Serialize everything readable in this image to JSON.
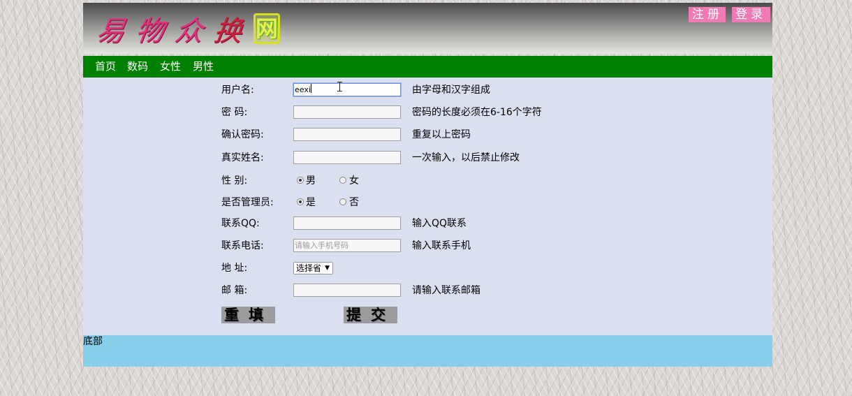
{
  "header": {
    "logo_chars": [
      "易",
      "物",
      "众",
      "换",
      "网"
    ],
    "register_label": "注册",
    "login_label": "登录",
    "logo_colors": {
      "pink": "#e4307a",
      "red": "#d01e36",
      "yellow": "#e8f050"
    }
  },
  "nav": {
    "items": [
      {
        "label": "首页"
      },
      {
        "label": "数码"
      },
      {
        "label": "女性"
      },
      {
        "label": "男性"
      }
    ]
  },
  "form": {
    "username": {
      "label": "用户名:",
      "value": "eexi",
      "hint": "由字母和汉字组成"
    },
    "password": {
      "label": "密 码:",
      "value": "",
      "hint": "密码的长度必须在6-16个字符"
    },
    "confirm_password": {
      "label": "确认密码:",
      "value": "",
      "hint": "重复以上密码"
    },
    "real_name": {
      "label": "真实姓名:",
      "value": "",
      "hint": "一次输入，以后禁止修改"
    },
    "gender": {
      "label": "性 别:",
      "options": [
        "男",
        "女"
      ],
      "selected": "男"
    },
    "is_admin": {
      "label": "是否管理员:",
      "options": [
        "是",
        "否"
      ],
      "selected": "是"
    },
    "qq": {
      "label": "联系QQ:",
      "value": "",
      "hint": "输入QQ联系"
    },
    "phone": {
      "label": "联系电话:",
      "value": "",
      "placeholder": "请输入手机号码",
      "hint": "输入联系手机"
    },
    "address": {
      "label": "地 址:",
      "selected": "选择省"
    },
    "email": {
      "label": "邮 箱:",
      "value": "",
      "hint": "请输入联系邮箱"
    },
    "reset_label": "重填",
    "submit_label": "提交"
  },
  "footer": {
    "text": "底部"
  },
  "colors": {
    "nav_bg": "#008000",
    "panel_bg": "#dae0ef",
    "footer_bg": "#87ceeb",
    "auth_btn_bg": "#f07ab4",
    "img_btn_bg": "#9c9c9c"
  }
}
